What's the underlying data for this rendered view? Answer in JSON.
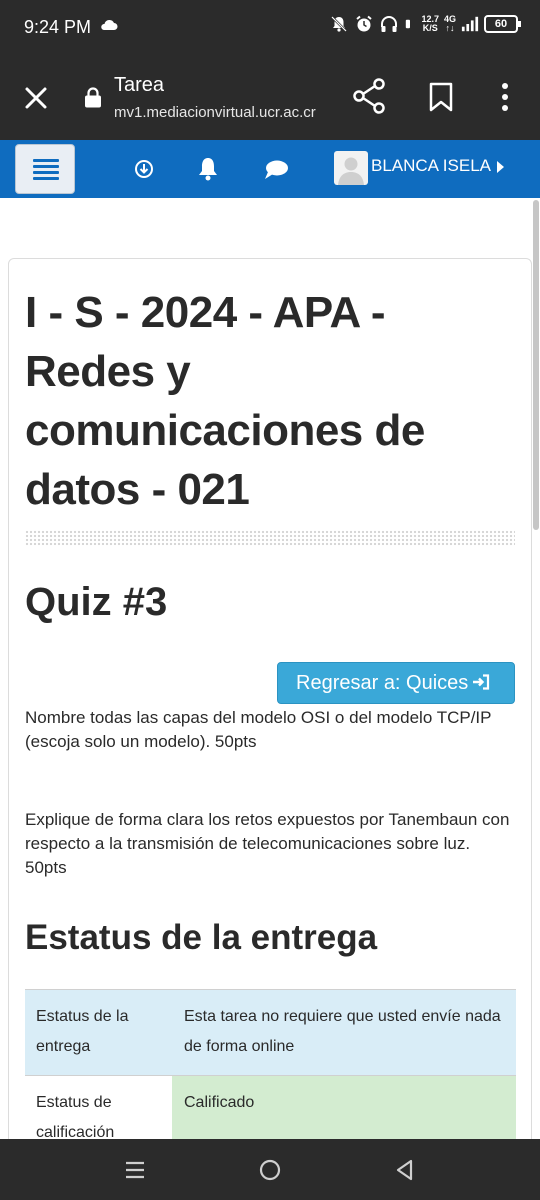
{
  "status_bar": {
    "time": "9:24 PM",
    "net_speed_value": "12.7",
    "net_speed_unit": "K/S",
    "network": "4G",
    "battery": "60"
  },
  "browser": {
    "page_title": "Tarea",
    "url": "mv1.mediacionvirtual.ucr.ac.cr"
  },
  "navbar": {
    "user_name": "BLANCA ISELA",
    "accent_color": "#0f6cbf"
  },
  "content": {
    "course_title": "I - S - 2024 - APA - Redes y comunicaciones de datos - 021",
    "quiz_title": "Quiz #3",
    "back_button_label": "Regresar a: Quices",
    "description_1": "Nombre todas las capas del modelo OSI o del modelo TCP/IP (escoja solo un modelo). 50pts",
    "description_2": "Explique de forma clara los retos expuestos por Tanembaun con respecto a la transmisión de telecomunicaciones sobre luz. 50pts",
    "status_heading": "Estatus de la entrega",
    "status_table": [
      {
        "label": "Estatus de la entrega",
        "value": "Esta tarea no requiere que usted envíe nada de forma online"
      },
      {
        "label": "Estatus de calificación",
        "value": "Calificado"
      }
    ]
  },
  "icons": {
    "close": "close-icon",
    "lock": "lock-icon",
    "share": "share-icon",
    "bookmark": "bookmark-icon",
    "more": "more-vert-icon",
    "menu": "hamburger-icon",
    "download": "download-icon",
    "notifications": "bell-icon",
    "messages": "chat-icon"
  }
}
